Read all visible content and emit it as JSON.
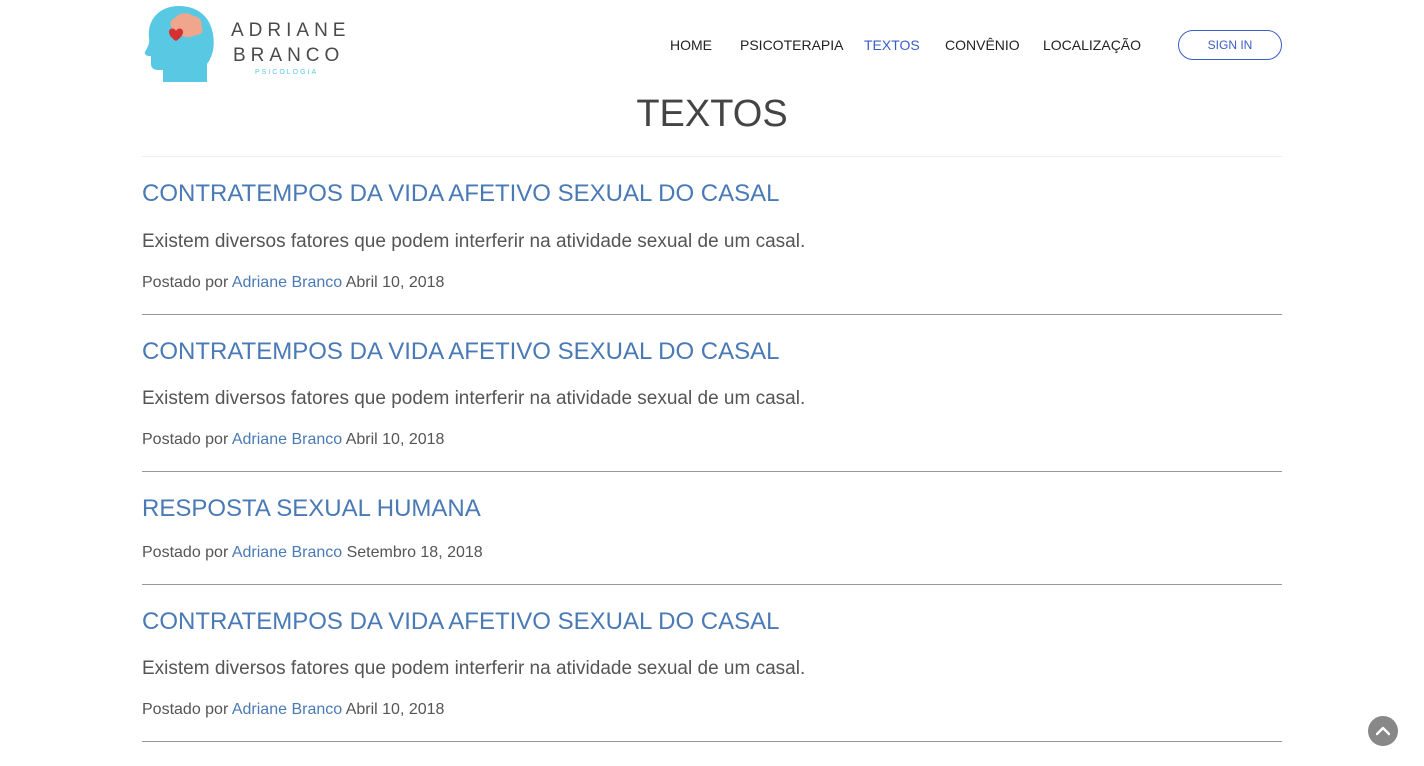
{
  "brand": {
    "line1": "ADRIANE",
    "line2": "BRANCO",
    "sub": "PSICOLOGIA",
    "icon": "head-heart-brain-logo",
    "colors": {
      "head": "#59c9e3",
      "heart": "#d63031",
      "brain": "#f0a68a"
    }
  },
  "nav": {
    "items": [
      {
        "label": "HOME",
        "active": false
      },
      {
        "label": "PSICOTERAPIA",
        "active": false
      },
      {
        "label": "TEXTOS",
        "active": true
      },
      {
        "label": "CONVÊNIO",
        "active": false
      },
      {
        "label": "LOCALIZAÇÃO",
        "active": false
      }
    ],
    "signin_label": "SIGN IN"
  },
  "page": {
    "title": "TEXTOS"
  },
  "posts": [
    {
      "title": "CONTRATEMPOS DA VIDA AFETIVO SEXUAL DO CASAL",
      "excerpt": "Existem diversos fatores que podem interferir na atividade sexual de um casal.",
      "posted_by": "Postado por",
      "author": "Adriane Branco",
      "date": "Abril 10, 2018"
    },
    {
      "title": "CONTRATEMPOS DA VIDA AFETIVO SEXUAL DO CASAL",
      "excerpt": "Existem diversos fatores que podem interferir na atividade sexual de um casal.",
      "posted_by": "Postado por",
      "author": "Adriane Branco",
      "date": "Abril 10, 2018"
    },
    {
      "title": "RESPOSTA SEXUAL HUMANA",
      "excerpt": "",
      "posted_by": "Postado por",
      "author": "Adriane Branco",
      "date": "Setembro 18, 2018"
    },
    {
      "title": "CONTRATEMPOS DA VIDA AFETIVO SEXUAL DO CASAL",
      "excerpt": "Existem diversos fatores que podem interferir na atividade sexual de um casal.",
      "posted_by": "Postado por",
      "author": "Adriane Branco",
      "date": "Abril 10, 2018"
    }
  ],
  "scroll_top": {
    "icon": "chevron-up-icon"
  },
  "colors": {
    "accent": "#3a5dc9",
    "link": "#4a7ab5",
    "text": "#555555"
  }
}
